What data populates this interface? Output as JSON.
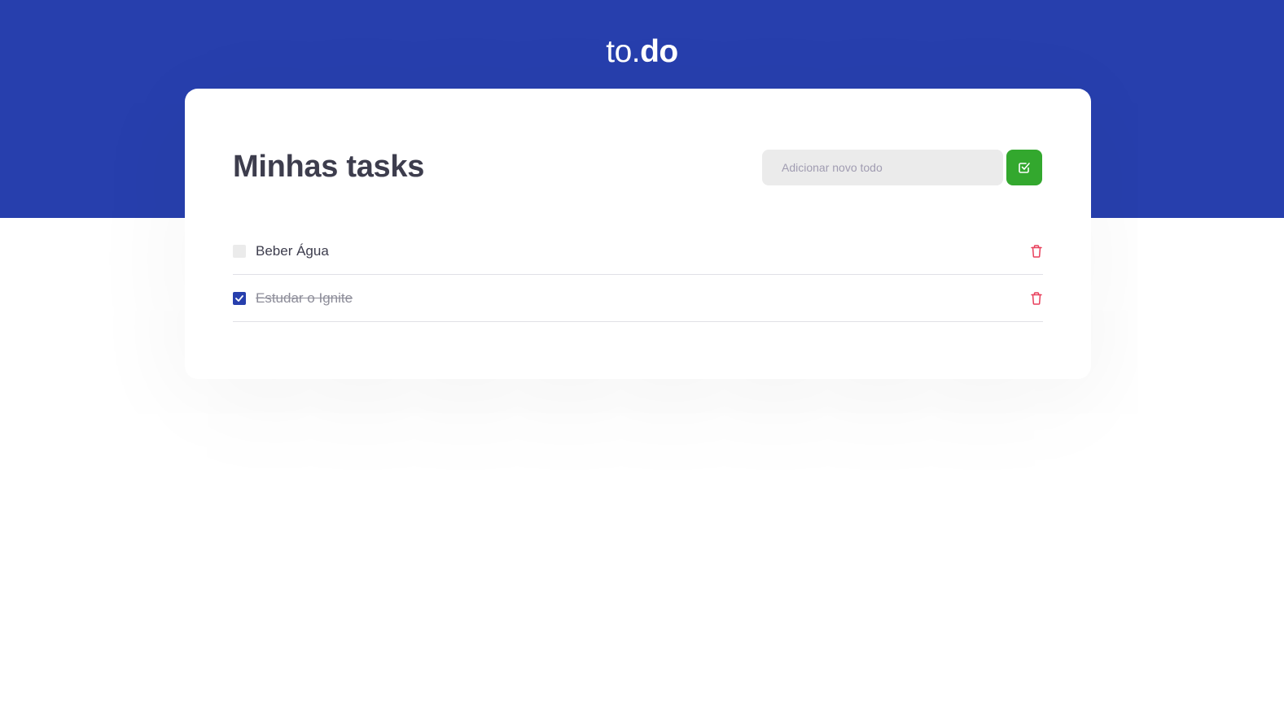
{
  "header": {
    "logo_light": "to.",
    "logo_bold": "do",
    "background_color": "#273fad"
  },
  "main": {
    "title": "Minhas tasks",
    "new_todo": {
      "placeholder": "Adicionar novo todo",
      "value": "",
      "add_button_icon": "check-square-icon",
      "add_button_color": "#33a82e"
    },
    "tasks": [
      {
        "title": "Beber Água",
        "completed": false,
        "delete_icon": "trash-icon"
      },
      {
        "title": "Estudar o Ignite",
        "completed": true,
        "delete_icon": "trash-icon"
      }
    ]
  },
  "colors": {
    "accent": "#273fad",
    "success": "#33a82e",
    "danger": "#e83f5b"
  }
}
